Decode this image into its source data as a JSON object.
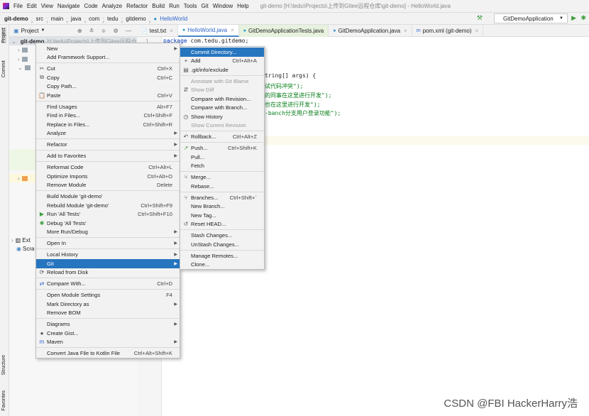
{
  "menubar": {
    "items": [
      "File",
      "Edit",
      "View",
      "Navigate",
      "Code",
      "Analyze",
      "Refactor",
      "Build",
      "Run",
      "Tools",
      "Git",
      "Window",
      "Help"
    ],
    "title": "git-demo [H:\\tedu\\Projects\\上传到Gitee远程仓库\\git-demo] - HelloWorld.java"
  },
  "breadcrumb": [
    "git-demo",
    "src",
    "main",
    "java",
    "com",
    "tedu",
    "gitdemo",
    "HelloWorld"
  ],
  "run_config": "GitDemoApplication",
  "left_strip": {
    "project": "Project",
    "commit": "Commit",
    "structure": "Structure",
    "favorites": "Favorites"
  },
  "project_panel": {
    "title": "Project",
    "root": "git-demo",
    "root_path": "H:\\tedu\\Projects\\上传到Gitee远程仓库",
    "ext": "Ext",
    "scratch": "Scra"
  },
  "tabs": [
    {
      "label": "test.txt"
    },
    {
      "label": "HelloWorld.java"
    },
    {
      "label": "GitDemoApplicationTests.java"
    },
    {
      "label": "GitDemoApplication.java"
    },
    {
      "label": "pom.xml (git-demo)"
    }
  ],
  "editor": {
    "line_no": "1",
    "line1_kw": "package",
    "line1": " com.tedu.gitdemo;",
    "line2": "tring[] args) {",
    "line3": "试代码冲突\");",
    "line4": "的同事在这里进行开发\");",
    "line5": "也在这里进行开发\");",
    "line6a": "-banch",
    "line6b": "分支用户登录功能\");"
  },
  "context_menu": [
    {
      "label": "New",
      "arrow": true
    },
    {
      "label": "Add Framework Support..."
    },
    {
      "sep": true
    },
    {
      "label": "Cut",
      "shortcut": "Ctrl+X",
      "icon": "✂"
    },
    {
      "label": "Copy",
      "shortcut": "Ctrl+C",
      "icon": "⧉"
    },
    {
      "label": "Copy Path..."
    },
    {
      "label": "Paste",
      "shortcut": "Ctrl+V",
      "icon": "📋"
    },
    {
      "sep": true
    },
    {
      "label": "Find Usages",
      "shortcut": "Alt+F7"
    },
    {
      "label": "Find in Files...",
      "shortcut": "Ctrl+Shift+F"
    },
    {
      "label": "Replace in Files...",
      "shortcut": "Ctrl+Shift+R"
    },
    {
      "label": "Analyze",
      "arrow": true
    },
    {
      "sep": true
    },
    {
      "label": "Refactor",
      "arrow": true
    },
    {
      "sep": true
    },
    {
      "label": "Add to Favorites",
      "arrow": true
    },
    {
      "sep": true
    },
    {
      "label": "Reformat Code",
      "shortcut": "Ctrl+Alt+L"
    },
    {
      "label": "Optimize Imports",
      "shortcut": "Ctrl+Alt+O"
    },
    {
      "label": "Remove Module",
      "shortcut": "Delete"
    },
    {
      "sep": true
    },
    {
      "label": "Build Module 'git-demo'"
    },
    {
      "label": "Rebuild Module 'git-demo'",
      "shortcut": "Ctrl+Shift+F9"
    },
    {
      "label": "Run 'All Tests'",
      "shortcut": "Ctrl+Shift+F10",
      "icon": "▶",
      "icon_color": "#3f9d3f"
    },
    {
      "label": "Debug 'All Tests'",
      "icon": "✱",
      "icon_color": "#3f9d3f"
    },
    {
      "label": "More Run/Debug",
      "arrow": true
    },
    {
      "sep": true
    },
    {
      "label": "Open In",
      "arrow": true
    },
    {
      "sep": true
    },
    {
      "label": "Local History",
      "arrow": true
    },
    {
      "label": "Git",
      "arrow": true,
      "highlight": true
    },
    {
      "label": "Reload from Disk",
      "icon": "⟳"
    },
    {
      "sep": true
    },
    {
      "label": "Compare With...",
      "shortcut": "Ctrl+D",
      "icon": "⇄",
      "icon_color": "#2f65ca"
    },
    {
      "sep": true
    },
    {
      "label": "Open Module Settings",
      "shortcut": "F4"
    },
    {
      "label": "Mark Directory as",
      "arrow": true
    },
    {
      "label": "Remove BOM"
    },
    {
      "sep": true
    },
    {
      "label": "Diagrams",
      "arrow": true
    },
    {
      "label": "Create Gist...",
      "icon": "●"
    },
    {
      "label": "Maven",
      "arrow": true,
      "icon": "m",
      "icon_color": "#2f65ca"
    },
    {
      "sep": true
    },
    {
      "label": "Convert Java File to Kotlin File",
      "shortcut": "Ctrl+Alt+Shift+K"
    }
  ],
  "git_submenu": [
    {
      "label": "Commit Directory...",
      "highlight": true
    },
    {
      "label": "Add",
      "shortcut": "Ctrl+Alt+A",
      "icon": "+"
    },
    {
      "label": ".git/info/exclude",
      "icon": "▤"
    },
    {
      "sep": true
    },
    {
      "label": "Annotate with Git Blame",
      "disabled": true
    },
    {
      "label": "Show Diff",
      "disabled": true,
      "icon": "⇵"
    },
    {
      "label": "Compare with Revision..."
    },
    {
      "label": "Compare with Branch..."
    },
    {
      "label": "Show History",
      "icon": "◷"
    },
    {
      "label": "Show Current Revision",
      "disabled": true
    },
    {
      "sep": true
    },
    {
      "label": "Rollback...",
      "shortcut": "Ctrl+Alt+Z",
      "icon": "↶"
    },
    {
      "sep": true
    },
    {
      "label": "Push...",
      "shortcut": "Ctrl+Shift+K",
      "icon": "↗",
      "icon_color": "#3f9d3f"
    },
    {
      "label": "Pull..."
    },
    {
      "label": "Fetch"
    },
    {
      "sep": true
    },
    {
      "label": "Merge...",
      "icon": "⑂"
    },
    {
      "label": "Rebase..."
    },
    {
      "sep": true
    },
    {
      "label": "Branches...",
      "shortcut": "Ctrl+Shift+`",
      "icon": "⑂"
    },
    {
      "label": "New Branch..."
    },
    {
      "label": "New Tag..."
    },
    {
      "label": "Reset HEAD...",
      "icon": "↺"
    },
    {
      "sep": true
    },
    {
      "label": "Stash Changes..."
    },
    {
      "label": "UnStash Changes..."
    },
    {
      "sep": true
    },
    {
      "label": "Manage Remotes..."
    },
    {
      "label": "Clone..."
    }
  ],
  "watermark": "CSDN @FBI HackerHarry浩"
}
